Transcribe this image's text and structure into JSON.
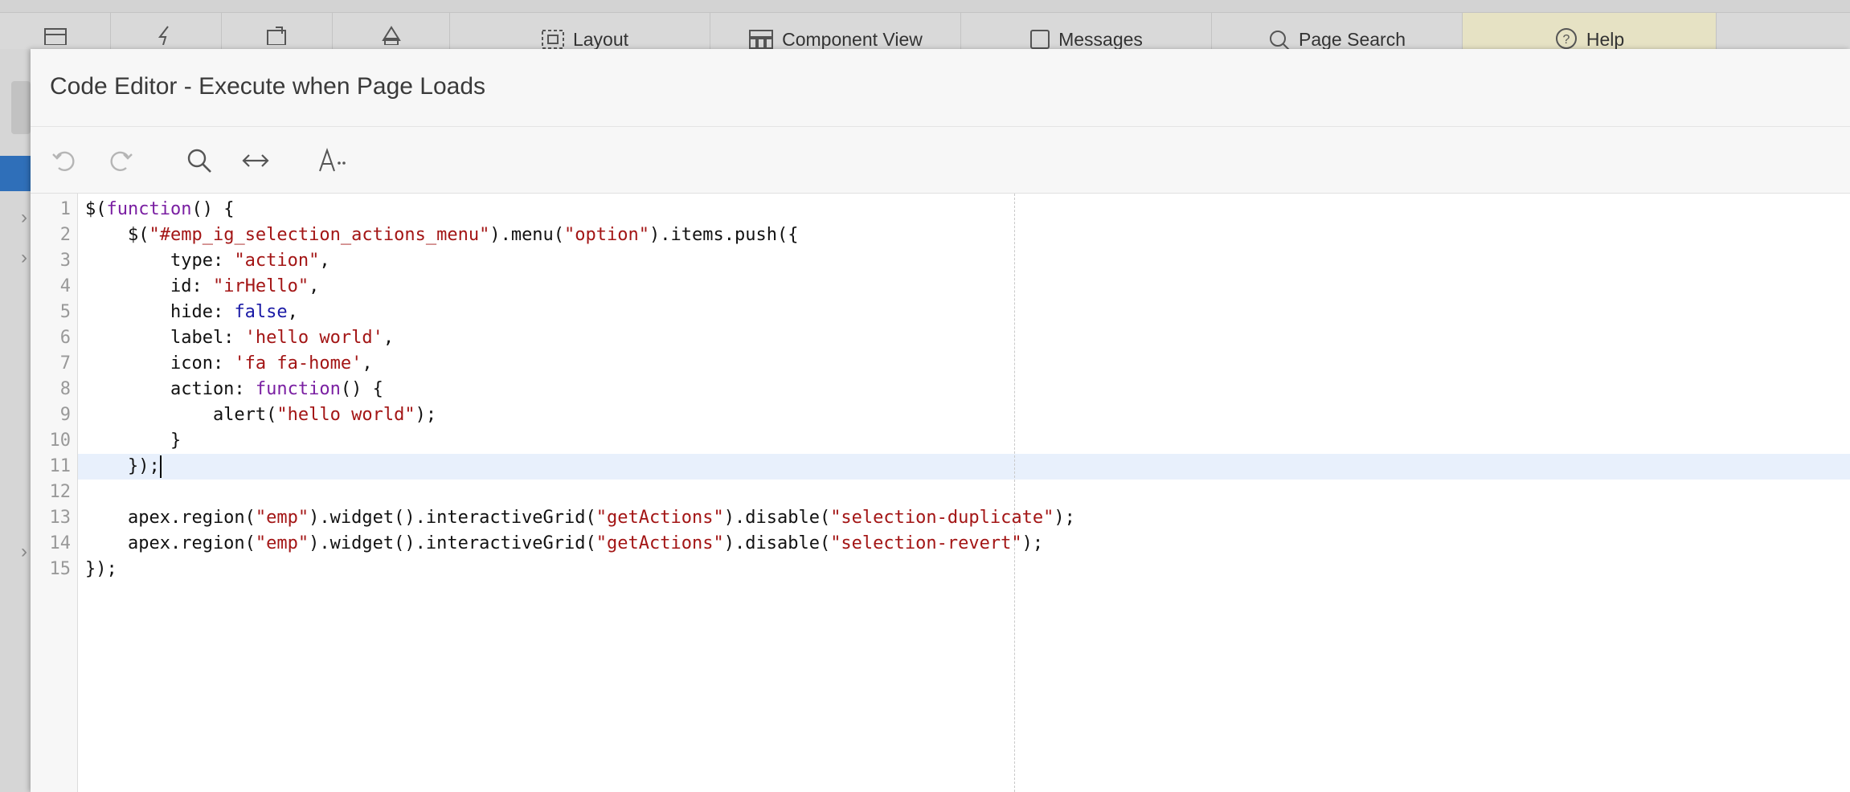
{
  "top_toolbar": {
    "buttons": [
      {
        "label": "Layout",
        "icon": "layout-icon"
      },
      {
        "label": "Component View",
        "icon": "component-view-icon"
      },
      {
        "label": "Messages",
        "icon": "messages-icon"
      },
      {
        "label": "Page Search",
        "icon": "search-icon"
      },
      {
        "label": "Help",
        "icon": "help-icon"
      }
    ],
    "icon_buttons": [
      "page-icon",
      "lightning-icon",
      "refresh-page-icon",
      "shared-components-icon"
    ]
  },
  "dialog": {
    "title": "Code Editor - Execute when Page Loads"
  },
  "editor_toolbar": {
    "icons": [
      "undo-icon",
      "redo-icon",
      "search-icon",
      "expand-horizontal-icon",
      "font-size-icon"
    ]
  },
  "editor": {
    "active_line": 11,
    "line_numbers": [
      "1",
      "2",
      "3",
      "4",
      "5",
      "6",
      "7",
      "8",
      "9",
      "10",
      "11",
      "12",
      "13",
      "14",
      "15"
    ],
    "lines": [
      [
        {
          "t": "$(",
          "c": "plain"
        },
        {
          "t": "function",
          "c": "kw"
        },
        {
          "t": "() {",
          "c": "plain"
        }
      ],
      [
        {
          "t": "    $(",
          "c": "plain"
        },
        {
          "t": "\"#emp_ig_selection_actions_menu\"",
          "c": "str"
        },
        {
          "t": ").menu(",
          "c": "plain"
        },
        {
          "t": "\"option\"",
          "c": "str"
        },
        {
          "t": ").items.push({",
          "c": "plain"
        }
      ],
      [
        {
          "t": "        type: ",
          "c": "plain"
        },
        {
          "t": "\"action\"",
          "c": "str"
        },
        {
          "t": ",",
          "c": "plain"
        }
      ],
      [
        {
          "t": "        id: ",
          "c": "plain"
        },
        {
          "t": "\"irHello\"",
          "c": "str"
        },
        {
          "t": ",",
          "c": "plain"
        }
      ],
      [
        {
          "t": "        hide: ",
          "c": "plain"
        },
        {
          "t": "false",
          "c": "bool"
        },
        {
          "t": ",",
          "c": "plain"
        }
      ],
      [
        {
          "t": "        label: ",
          "c": "plain"
        },
        {
          "t": "'hello world'",
          "c": "str"
        },
        {
          "t": ",",
          "c": "plain"
        }
      ],
      [
        {
          "t": "        icon: ",
          "c": "plain"
        },
        {
          "t": "'fa fa-home'",
          "c": "str"
        },
        {
          "t": ",",
          "c": "plain"
        }
      ],
      [
        {
          "t": "        action: ",
          "c": "plain"
        },
        {
          "t": "function",
          "c": "kw"
        },
        {
          "t": "() {",
          "c": "plain"
        }
      ],
      [
        {
          "t": "            alert(",
          "c": "plain"
        },
        {
          "t": "\"hello world\"",
          "c": "str"
        },
        {
          "t": ");",
          "c": "plain"
        }
      ],
      [
        {
          "t": "        }",
          "c": "plain"
        }
      ],
      [
        {
          "t": "    });",
          "c": "plain"
        }
      ],
      [
        {
          "t": "",
          "c": "plain"
        }
      ],
      [
        {
          "t": "    apex.region(",
          "c": "plain"
        },
        {
          "t": "\"emp\"",
          "c": "str"
        },
        {
          "t": ").widget().interactiveGrid(",
          "c": "plain"
        },
        {
          "t": "\"getActions\"",
          "c": "str"
        },
        {
          "t": ").disable(",
          "c": "plain"
        },
        {
          "t": "\"selection-duplicate\"",
          "c": "str"
        },
        {
          "t": ");",
          "c": "plain"
        }
      ],
      [
        {
          "t": "    apex.region(",
          "c": "plain"
        },
        {
          "t": "\"emp\"",
          "c": "str"
        },
        {
          "t": ").widget().interactiveGrid(",
          "c": "plain"
        },
        {
          "t": "\"getActions\"",
          "c": "str"
        },
        {
          "t": ").disable(",
          "c": "plain"
        },
        {
          "t": "\"selection-revert\"",
          "c": "str"
        },
        {
          "t": ");",
          "c": "plain"
        }
      ],
      [
        {
          "t": "});",
          "c": "plain"
        }
      ]
    ]
  },
  "colors": {
    "keyword": "#7a1fa2",
    "string": "#a31515",
    "boolean": "#1a1aa6",
    "active_line": "#e8f0fc",
    "selected_sidebar": "#2f6fb9"
  }
}
